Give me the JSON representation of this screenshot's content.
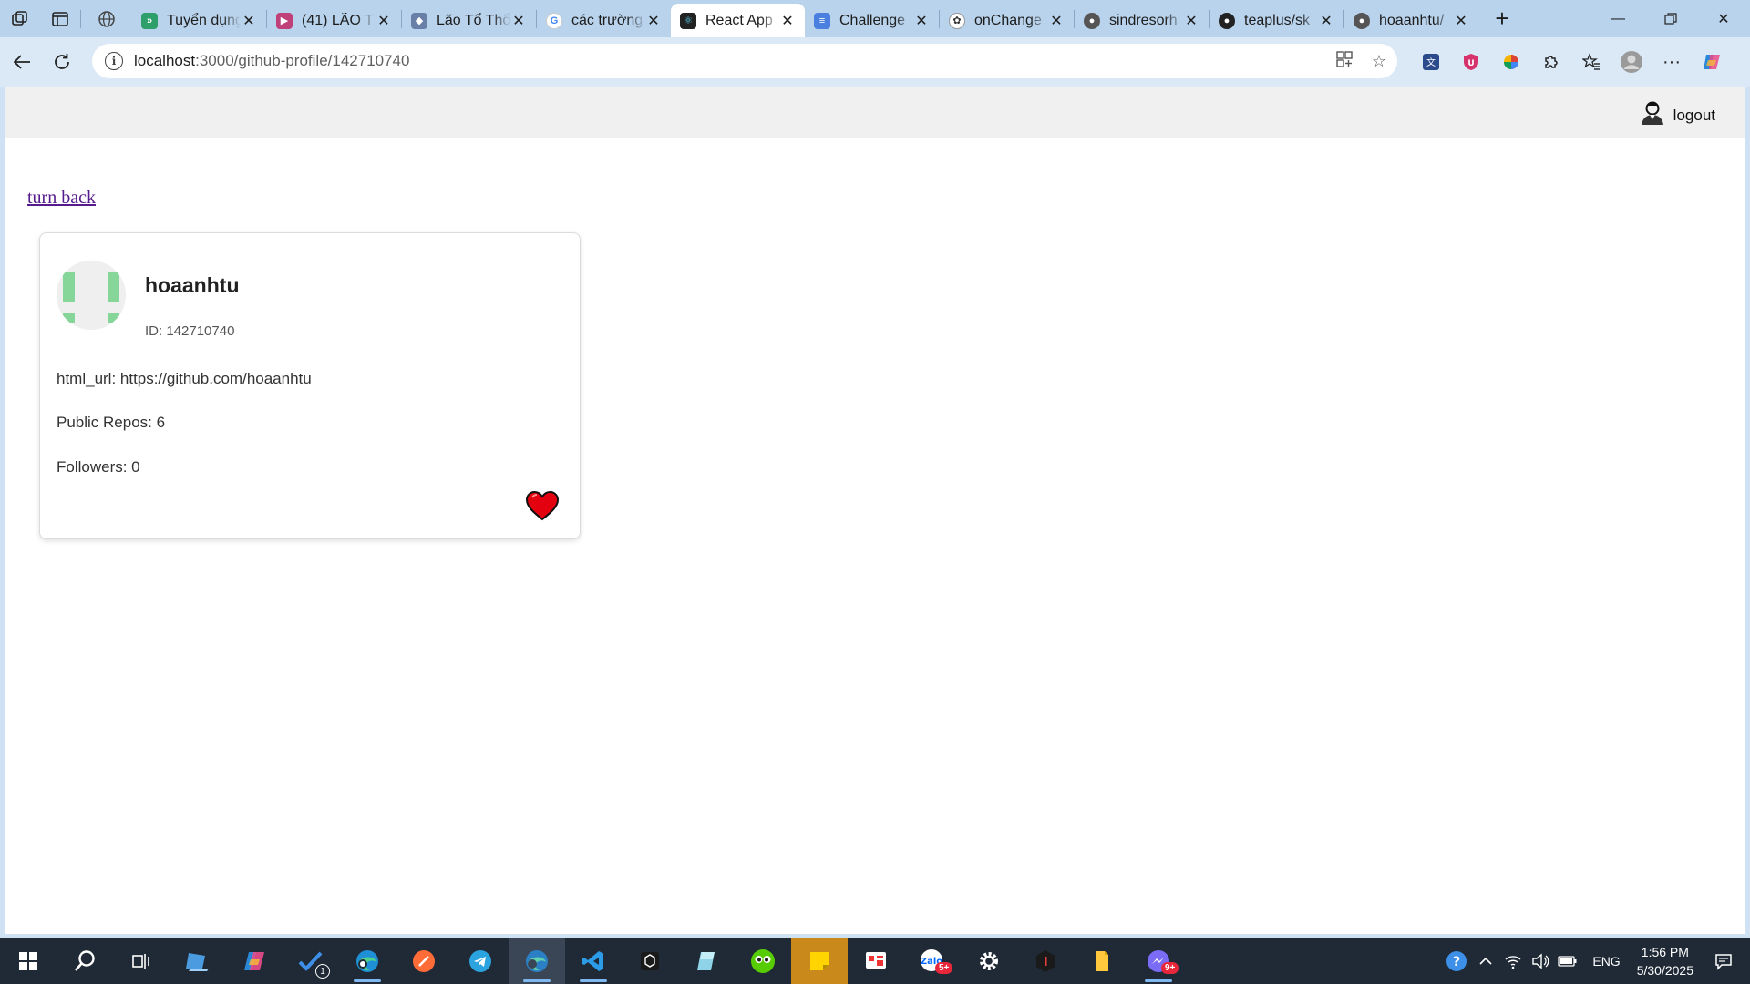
{
  "browser": {
    "tabs": [
      {
        "title": "Tuyển dụng",
        "favicon": "green-chevrons-icon",
        "color": "#2e9e6a"
      },
      {
        "title": "(41) LÃO T",
        "favicon": "video-icon",
        "color": "#c0407a"
      },
      {
        "title": "Lão Tổ Thổ",
        "favicon": "bird-icon",
        "color": "#6a7fa8"
      },
      {
        "title": "các trường",
        "favicon": "google-icon",
        "color": "#4285f4"
      },
      {
        "title": "React App",
        "favicon": "react-icon",
        "color": "#222222",
        "active": true
      },
      {
        "title": "Challenge",
        "favicon": "docs-icon",
        "color": "#4a7fe0"
      },
      {
        "title": "onChange",
        "favicon": "openai-icon",
        "color": "#333333"
      },
      {
        "title": "sindresorh",
        "favicon": "github-icon",
        "color": "#555555"
      },
      {
        "title": "teaplus/sk",
        "favicon": "github-icon",
        "color": "#222222"
      },
      {
        "title": "hoaanhtu/",
        "favicon": "github-icon",
        "color": "#555555"
      }
    ],
    "address": {
      "host": "localhost",
      "path": ":3000/github-profile/142710740"
    }
  },
  "header": {
    "logout_label": "logout"
  },
  "page": {
    "back_link": "turn back",
    "profile": {
      "username": "hoaanhtu",
      "id_text": "ID: 142710740",
      "html_url_text": "html_url: https://github.com/hoaanhtu",
      "repos_text": "Public Repos: 6",
      "followers_text": "Followers: 0"
    },
    "favorite_icon": "heart-icon"
  },
  "taskbar": {
    "task_badge": "1",
    "zalo_badge": "5+",
    "messenger_badge": "9+",
    "language": "ENG",
    "time": "1:56 PM",
    "date": "5/30/2025"
  }
}
